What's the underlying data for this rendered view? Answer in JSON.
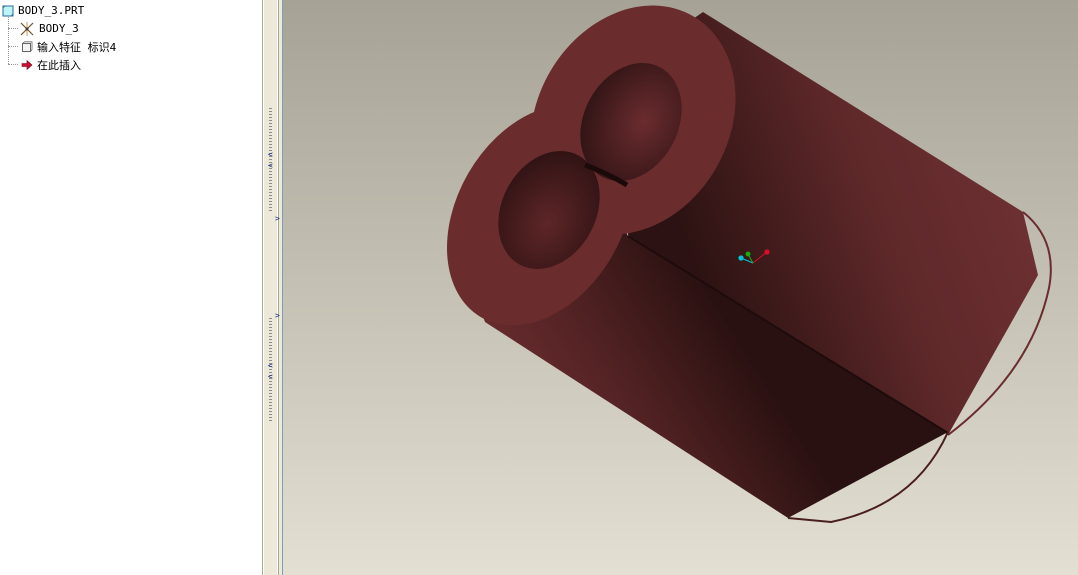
{
  "model_tree": {
    "root": {
      "label": "BODY_3.PRT",
      "icon": "part-icon"
    },
    "items": [
      {
        "label": "BODY_3",
        "icon": "coordinate-system-icon"
      },
      {
        "label": "输入特征 标识4",
        "icon": "import-feature-icon"
      },
      {
        "label": "在此插入",
        "icon": "insert-here-arrow-icon"
      }
    ]
  },
  "colors": {
    "model_body": "#6b2c2e",
    "viewport_top": "#a6a295",
    "viewport_bottom": "#e3e0d3",
    "sash": "#ece9d8",
    "insert_arrow": "#c8102e"
  }
}
